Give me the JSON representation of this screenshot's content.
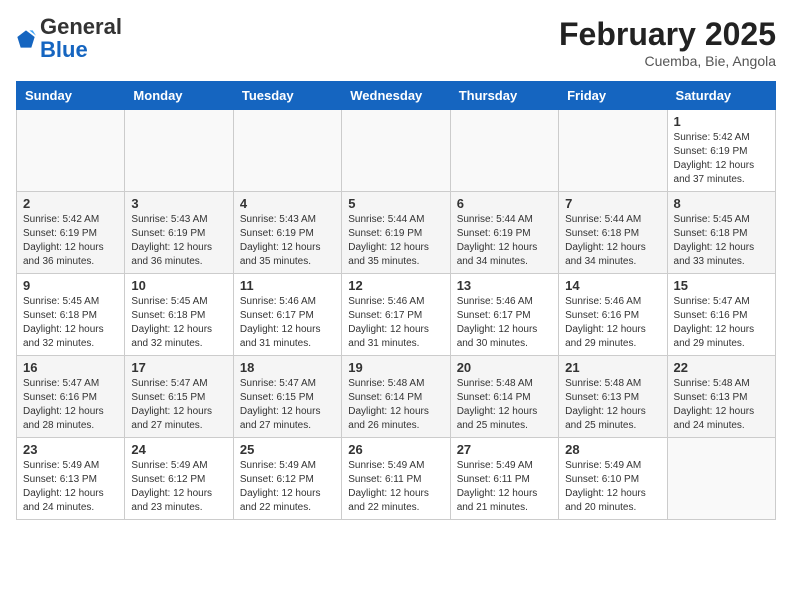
{
  "header": {
    "logo": {
      "general": "General",
      "blue": "Blue"
    },
    "title": "February 2025",
    "location": "Cuemba, Bie, Angola"
  },
  "days_of_week": [
    "Sunday",
    "Monday",
    "Tuesday",
    "Wednesday",
    "Thursday",
    "Friday",
    "Saturday"
  ],
  "weeks": [
    [
      {
        "day": "",
        "info": ""
      },
      {
        "day": "",
        "info": ""
      },
      {
        "day": "",
        "info": ""
      },
      {
        "day": "",
        "info": ""
      },
      {
        "day": "",
        "info": ""
      },
      {
        "day": "",
        "info": ""
      },
      {
        "day": "1",
        "info": "Sunrise: 5:42 AM\nSunset: 6:19 PM\nDaylight: 12 hours and 37 minutes."
      }
    ],
    [
      {
        "day": "2",
        "info": "Sunrise: 5:42 AM\nSunset: 6:19 PM\nDaylight: 12 hours and 36 minutes."
      },
      {
        "day": "3",
        "info": "Sunrise: 5:43 AM\nSunset: 6:19 PM\nDaylight: 12 hours and 36 minutes."
      },
      {
        "day": "4",
        "info": "Sunrise: 5:43 AM\nSunset: 6:19 PM\nDaylight: 12 hours and 35 minutes."
      },
      {
        "day": "5",
        "info": "Sunrise: 5:44 AM\nSunset: 6:19 PM\nDaylight: 12 hours and 35 minutes."
      },
      {
        "day": "6",
        "info": "Sunrise: 5:44 AM\nSunset: 6:19 PM\nDaylight: 12 hours and 34 minutes."
      },
      {
        "day": "7",
        "info": "Sunrise: 5:44 AM\nSunset: 6:18 PM\nDaylight: 12 hours and 34 minutes."
      },
      {
        "day": "8",
        "info": "Sunrise: 5:45 AM\nSunset: 6:18 PM\nDaylight: 12 hours and 33 minutes."
      }
    ],
    [
      {
        "day": "9",
        "info": "Sunrise: 5:45 AM\nSunset: 6:18 PM\nDaylight: 12 hours and 32 minutes."
      },
      {
        "day": "10",
        "info": "Sunrise: 5:45 AM\nSunset: 6:18 PM\nDaylight: 12 hours and 32 minutes."
      },
      {
        "day": "11",
        "info": "Sunrise: 5:46 AM\nSunset: 6:17 PM\nDaylight: 12 hours and 31 minutes."
      },
      {
        "day": "12",
        "info": "Sunrise: 5:46 AM\nSunset: 6:17 PM\nDaylight: 12 hours and 31 minutes."
      },
      {
        "day": "13",
        "info": "Sunrise: 5:46 AM\nSunset: 6:17 PM\nDaylight: 12 hours and 30 minutes."
      },
      {
        "day": "14",
        "info": "Sunrise: 5:46 AM\nSunset: 6:16 PM\nDaylight: 12 hours and 29 minutes."
      },
      {
        "day": "15",
        "info": "Sunrise: 5:47 AM\nSunset: 6:16 PM\nDaylight: 12 hours and 29 minutes."
      }
    ],
    [
      {
        "day": "16",
        "info": "Sunrise: 5:47 AM\nSunset: 6:16 PM\nDaylight: 12 hours and 28 minutes."
      },
      {
        "day": "17",
        "info": "Sunrise: 5:47 AM\nSunset: 6:15 PM\nDaylight: 12 hours and 27 minutes."
      },
      {
        "day": "18",
        "info": "Sunrise: 5:47 AM\nSunset: 6:15 PM\nDaylight: 12 hours and 27 minutes."
      },
      {
        "day": "19",
        "info": "Sunrise: 5:48 AM\nSunset: 6:14 PM\nDaylight: 12 hours and 26 minutes."
      },
      {
        "day": "20",
        "info": "Sunrise: 5:48 AM\nSunset: 6:14 PM\nDaylight: 12 hours and 25 minutes."
      },
      {
        "day": "21",
        "info": "Sunrise: 5:48 AM\nSunset: 6:13 PM\nDaylight: 12 hours and 25 minutes."
      },
      {
        "day": "22",
        "info": "Sunrise: 5:48 AM\nSunset: 6:13 PM\nDaylight: 12 hours and 24 minutes."
      }
    ],
    [
      {
        "day": "23",
        "info": "Sunrise: 5:49 AM\nSunset: 6:13 PM\nDaylight: 12 hours and 24 minutes."
      },
      {
        "day": "24",
        "info": "Sunrise: 5:49 AM\nSunset: 6:12 PM\nDaylight: 12 hours and 23 minutes."
      },
      {
        "day": "25",
        "info": "Sunrise: 5:49 AM\nSunset: 6:12 PM\nDaylight: 12 hours and 22 minutes."
      },
      {
        "day": "26",
        "info": "Sunrise: 5:49 AM\nSunset: 6:11 PM\nDaylight: 12 hours and 22 minutes."
      },
      {
        "day": "27",
        "info": "Sunrise: 5:49 AM\nSunset: 6:11 PM\nDaylight: 12 hours and 21 minutes."
      },
      {
        "day": "28",
        "info": "Sunrise: 5:49 AM\nSunset: 6:10 PM\nDaylight: 12 hours and 20 minutes."
      },
      {
        "day": "",
        "info": ""
      }
    ]
  ]
}
